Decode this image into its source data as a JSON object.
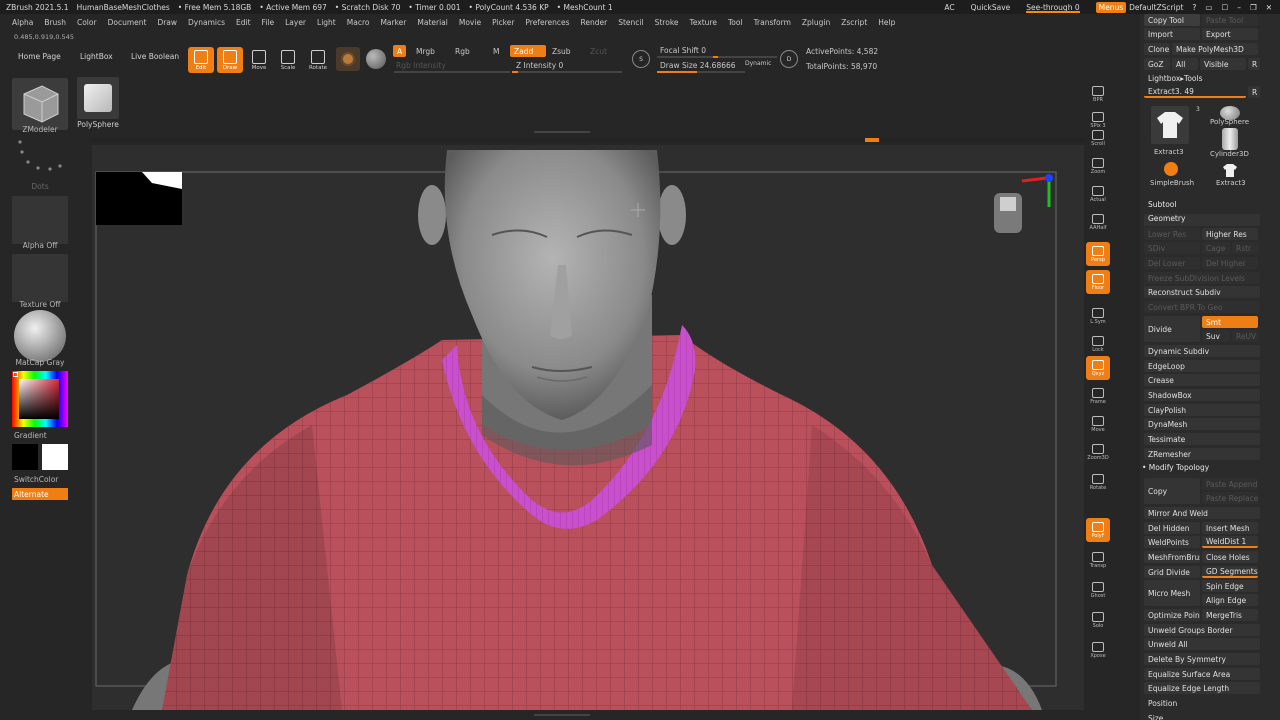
{
  "titlebar": {
    "app": "ZBrush 2021.5.1",
    "document": "HumanBaseMeshClothes",
    "free_mem": "• Free Mem 5.18GB",
    "active_mem": "• Active Mem 697",
    "scratch_disk": "• Scratch Disk 70",
    "timer": "• Timer 0.001",
    "poly_count": "• PolyCount 4.536 KP",
    "mesh_count": "• MeshCount 1",
    "ac": "AC",
    "quicksave": "QuickSave",
    "see_through": "See-through  0",
    "menus": "Menus",
    "script": "DefaultZScript"
  },
  "menubar": {
    "items": [
      "Alpha",
      "Brush",
      "Color",
      "Document",
      "Draw",
      "Dynamics",
      "Edit",
      "File",
      "Layer",
      "Light",
      "Macro",
      "Marker",
      "Material",
      "Movie",
      "Picker",
      "Preferences",
      "Render",
      "Stencil",
      "Stroke",
      "Texture",
      "Tool",
      "Transform",
      "Zplugin",
      "Zscript",
      "Help"
    ]
  },
  "coord_readout": "0.485,0.919,0.545",
  "toolbar": {
    "tabs": [
      "Home Page",
      "LightBox",
      "Live Boolean"
    ],
    "tools": [
      {
        "label": "Edit",
        "active": true
      },
      {
        "label": "Draw",
        "active": true
      },
      {
        "label": "Move",
        "active": false
      },
      {
        "label": "Scale",
        "active": false
      },
      {
        "label": "Rotate",
        "active": false
      }
    ],
    "a_label": "A",
    "mrgb": "Mrgb",
    "rgb": "Rgb",
    "m": "M",
    "zadd": "Zadd",
    "zsub": "Zsub",
    "zcut": "Zcut",
    "rgb_intensity": "Rgb Intensity",
    "z_intensity": "Z Intensity 0",
    "focal_shift": "Focal Shift 0",
    "draw_size": "Draw Size 24.68666",
    "dynamic": "Dynamic",
    "active_points": "ActivePoints: 4,582",
    "total_points": "TotalPoints: 58,970"
  },
  "leftshelf": {
    "zmodeler": "ZModeler",
    "polysphere": "PolySphere",
    "dots": "Dots",
    "alpha": "Alpha Off",
    "texture": "Texture Off",
    "matcap": "MatCap Gray",
    "gradient": "Gradient",
    "switchcolor": "SwitchColor",
    "alternate": "Alternate"
  },
  "iconcol": {
    "items": [
      {
        "label": "BPR",
        "active": false
      },
      {
        "label": "SPix 3",
        "active": false
      },
      {
        "label": "Scroll",
        "active": false
      },
      {
        "label": "Zoom",
        "active": false
      },
      {
        "label": "Actual",
        "active": false
      },
      {
        "label": "AAHalf",
        "active": false
      },
      {
        "label": "Persp",
        "active": true
      },
      {
        "label": "Floor",
        "active": true
      },
      {
        "label": "L.Sym",
        "active": false
      },
      {
        "label": "Lock",
        "active": false
      },
      {
        "label": "Qxyz",
        "active": true
      },
      {
        "label": "Frame",
        "active": false
      },
      {
        "label": "Move",
        "active": false
      },
      {
        "label": "Zoom3D",
        "active": false
      },
      {
        "label": "Rotate",
        "active": false
      },
      {
        "label": "PolyF",
        "active": true
      },
      {
        "label": "Transp",
        "active": false
      },
      {
        "label": "Ghost",
        "active": false
      },
      {
        "label": "Solo",
        "active": false
      },
      {
        "label": "Xpose",
        "active": false
      }
    ]
  },
  "rpanel": {
    "copy_tool": "Copy Tool",
    "paste_tool": "Paste Tool",
    "import": "Import",
    "export": "Export",
    "clone": "Clone",
    "make_polymesh": "Make PolyMesh3D",
    "goz": "GoZ",
    "all": "All",
    "visible": "Visible",
    "r": "R",
    "lightbox_tools": "Lightbox▸Tools",
    "extract_slider": "Extract3. 49",
    "thumbs": [
      "Extract3",
      "PolySphere",
      "Cylinder3D",
      "SimpleBrush",
      "Extract3"
    ],
    "thumb_count": "3",
    "subtool": "Subtool",
    "geometry": "Geometry",
    "lower_res": "Lower Res",
    "higher_res": "Higher Res",
    "sdiv": "SDiv",
    "cage": "Cage",
    "rstr": "Rstr",
    "del_lower": "Del Lower",
    "del_higher": "Del Higher",
    "freeze": "Freeze SubDivision Levels",
    "reconstruct": "Reconstruct Subdiv",
    "convert_bpr": "Convert BPR To Geo",
    "divide": "Divide",
    "smt": "Smt",
    "suv": "Suv",
    "reuv": "ReUV",
    "dynamic_subdiv": "Dynamic Subdiv",
    "edgeloop": "EdgeLoop",
    "crease": "Crease",
    "shadowbox": "ShadowBox",
    "claypolish": "ClayPolish",
    "dynamesh": "DynaMesh",
    "tessimate": "Tessimate",
    "zremesher": "ZRemesher",
    "modify_topology": "• Modify Topology",
    "copy": "Copy",
    "paste_append": "Paste Append",
    "paste_replace": "Paste Replace",
    "mirror_weld": "Mirror And Weld",
    "del_hidden": "Del Hidden",
    "insert_mesh": "Insert Mesh",
    "weldpoints": "WeldPoints",
    "welddist": "WeldDist 1",
    "meshfrombrush": "MeshFromBrus",
    "close_holes": "Close Holes",
    "grid_divide": "Grid Divide",
    "gd_segments": "GD Segments",
    "micro_mesh": "Micro Mesh",
    "spin_edge": "Spin Edge",
    "align_edge": "Align Edge",
    "optimize_points": "Optimize Points",
    "mergetris": "MergeTris",
    "unweld_border": "Unweld Groups Border",
    "unweld_all": "Unweld All",
    "delete_symmetry": "Delete By Symmetry",
    "equalize_area": "Equalize Surface Area",
    "equalize_edge": "Equalize Edge Length",
    "position": "Position",
    "size": "Size"
  },
  "colors": {
    "accent": "#ef7e14",
    "shirt": "#b9505c",
    "collar": "#c94fcc",
    "skin": "#8f8f8f"
  }
}
